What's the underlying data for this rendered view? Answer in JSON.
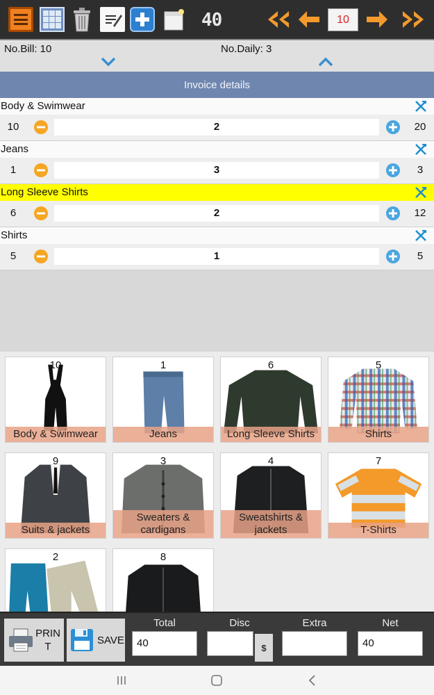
{
  "toolbar": {
    "icons": [
      "menu-icon",
      "grid-icon",
      "trash-icon",
      "notes-icon",
      "add-icon",
      "document-icon"
    ],
    "count_badge": "40",
    "current_page": "10"
  },
  "counts": {
    "bill": "No.Bill: 10",
    "daily": "No.Daily: 3"
  },
  "invoice": {
    "title": "Invoice details",
    "items": [
      {
        "name": "Body & Swimwear",
        "price": "10",
        "qty": "2",
        "total": "20",
        "highlight": false
      },
      {
        "name": "Jeans",
        "price": "1",
        "qty": "3",
        "total": "3",
        "highlight": false
      },
      {
        "name": "Long Sleeve Shirts",
        "price": "6",
        "qty": "2",
        "total": "12",
        "highlight": true
      },
      {
        "name": "Shirts",
        "price": "5",
        "qty": "1",
        "total": "5",
        "highlight": false
      }
    ]
  },
  "products": [
    {
      "count": "10",
      "label": "Body & Swimwear"
    },
    {
      "count": "1",
      "label": "Jeans"
    },
    {
      "count": "6",
      "label": "Long Sleeve Shirts"
    },
    {
      "count": "5",
      "label": "Shirts"
    },
    {
      "count": "9",
      "label": "Suits & jackets"
    },
    {
      "count": "3",
      "label": "Sweaters & cardigans"
    },
    {
      "count": "4",
      "label": "Sweatshirts & jackets"
    },
    {
      "count": "7",
      "label": "T-Shirts"
    },
    {
      "count": "2",
      "label": ""
    },
    {
      "count": "8",
      "label": ""
    }
  ],
  "footer": {
    "print_label": "PRINT",
    "save_label": "SAVE",
    "total_label": "Total",
    "total_value": "40",
    "disc_label": "Disc",
    "disc_value": "",
    "currency": "$",
    "extra_label": "Extra",
    "extra_value": "",
    "net_label": "Net",
    "net_value": "40"
  },
  "colors": {
    "accent_orange": "#f08020",
    "header_blue": "#6f87ae",
    "highlight_yellow": "#ffff00",
    "label_salmon": "#e8a286"
  }
}
